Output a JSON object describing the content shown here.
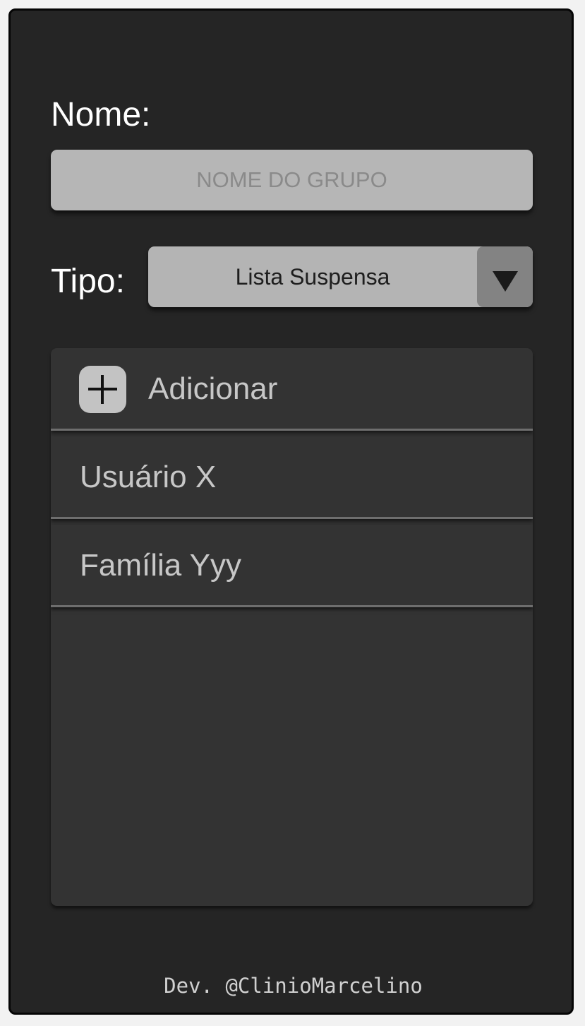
{
  "form": {
    "name_label": "Nome:",
    "name_placeholder": "NOME DO GRUPO",
    "name_value": "",
    "type_label": "Tipo:",
    "type_selected": "Lista Suspensa"
  },
  "list": {
    "add_label": "Adicionar",
    "items": [
      {
        "label": "Usuário X"
      },
      {
        "label": "Família Yyy"
      }
    ]
  },
  "footer": {
    "credit": "Dev. @ClinioMarcelino"
  },
  "icons": {
    "add": "plus-icon",
    "dropdown": "triangle-down-icon"
  },
  "colors": {
    "background": "#252525",
    "input": "#b6b6b6",
    "list": "#333333",
    "accent_button": "#838383"
  }
}
